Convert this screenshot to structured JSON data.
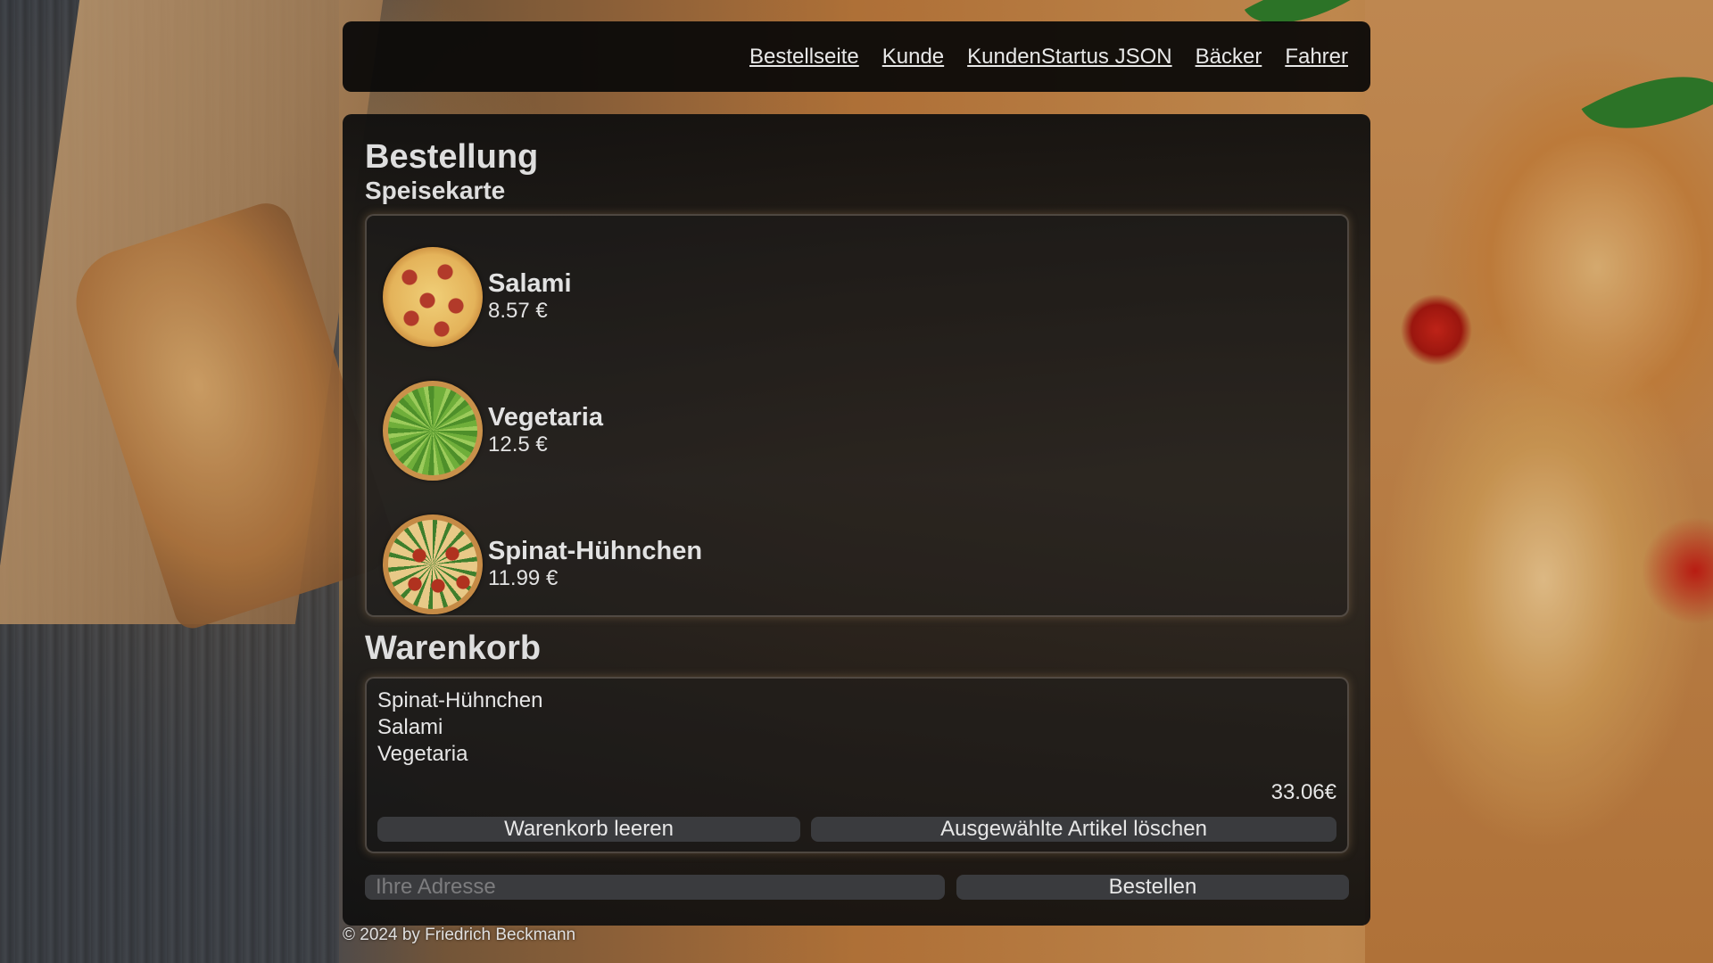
{
  "nav": {
    "links": [
      "Bestellseite",
      "Kunde",
      "KundenStartus JSON",
      "Bäcker",
      "Fahrer"
    ]
  },
  "page": {
    "title": "Bestellung",
    "menu_title": "Speisekarte"
  },
  "menu": {
    "items": [
      {
        "name": "Salami",
        "price": "8.57 €",
        "image": "salami-pizza"
      },
      {
        "name": "Vegetaria",
        "price": "12.5 €",
        "image": "vegetarian-pizza"
      },
      {
        "name": "Spinat-Hühnchen",
        "price": "11.99 €",
        "image": "spinach-chicken-pizza"
      }
    ]
  },
  "cart": {
    "title": "Warenkorb",
    "items": [
      "Spinat-Hühnchen",
      "Salami",
      "Vegetaria"
    ],
    "total": "33.06€",
    "clear_label": "Warenkorb leeren",
    "delete_label": "Ausgewählte Artikel löschen"
  },
  "order": {
    "address_value": "",
    "address_placeholder": "Ihre Adresse",
    "submit_label": "Bestellen"
  },
  "footer": {
    "text": "© 2024 by Friedrich Beckmann"
  }
}
